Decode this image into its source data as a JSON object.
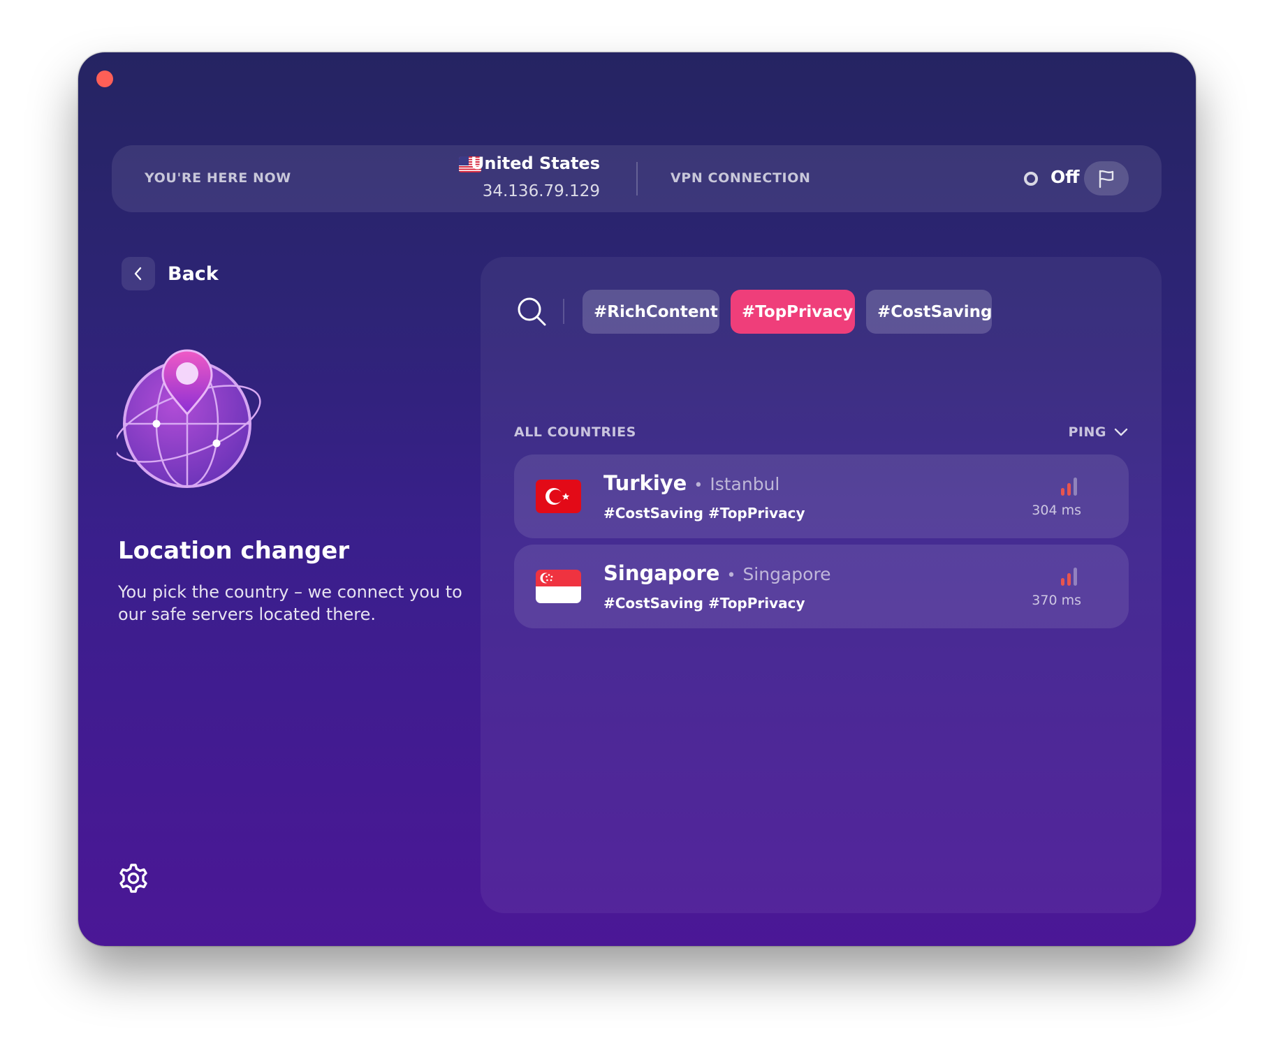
{
  "header": {
    "location_label": "YOU'RE HERE NOW",
    "country": "United States",
    "ip": "34.136.79.129",
    "vpn_label": "VPN CONNECTION",
    "vpn_status": "Off"
  },
  "back": {
    "label": "Back"
  },
  "hero": {
    "title": "Location changer",
    "description": "You pick the country – we connect you to our safe servers located there."
  },
  "filters": {
    "chips": [
      {
        "label": "#RichContent",
        "active": false
      },
      {
        "label": "#TopPrivacy",
        "active": true
      },
      {
        "label": "#CostSaving",
        "active": false
      }
    ]
  },
  "list": {
    "header": "ALL COUNTRIES",
    "sort_label": "PING",
    "rows": [
      {
        "country": "Turkiye",
        "city": "Istanbul",
        "tags": "#CostSaving #TopPrivacy",
        "ping": "304 ms",
        "signal_bars": 2
      },
      {
        "country": "Singapore",
        "city": "Singapore",
        "tags": "#CostSaving #TopPrivacy",
        "ping": "370 ms",
        "signal_bars": 2
      }
    ]
  },
  "icons": {
    "close": "traffic-light-close",
    "report": "flag-icon",
    "back": "chevron-left-icon",
    "search": "search-icon",
    "sort": "chevron-down-icon",
    "settings": "gear-icon"
  },
  "colors": {
    "accent": "#ef3e7a",
    "background_top": "#252462",
    "background_bottom": "#4b1796",
    "signal_active": "#e8554e"
  }
}
